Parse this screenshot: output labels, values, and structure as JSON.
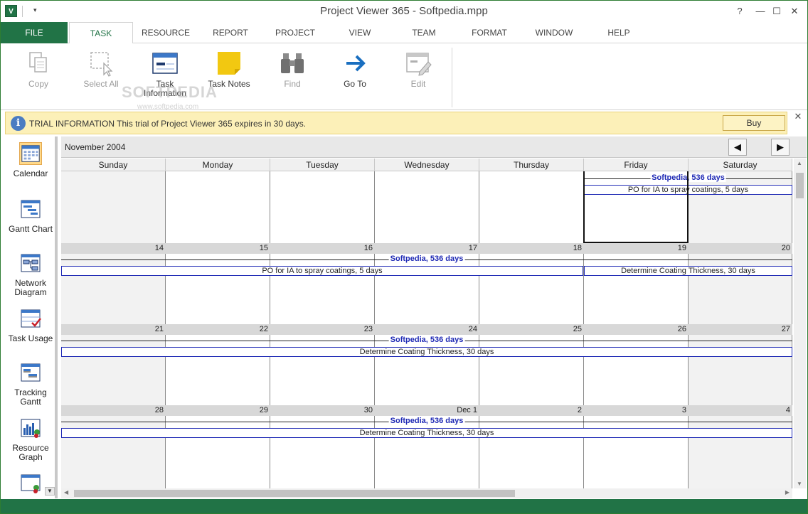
{
  "window": {
    "title": "Project Viewer 365 - Softpedia.mpp",
    "app_icon_text": "V",
    "controls": {
      "help": "?",
      "minimize": "—",
      "maximize": "☐",
      "close": "✕"
    }
  },
  "tabs": {
    "file": "FILE",
    "items": [
      {
        "label": "TASK"
      },
      {
        "label": "RESOURCE"
      },
      {
        "label": "REPORT"
      },
      {
        "label": "PROJECT"
      },
      {
        "label": "VIEW"
      },
      {
        "label": "TEAM"
      },
      {
        "label": "FORMAT"
      },
      {
        "label": "WINDOW"
      },
      {
        "label": "HELP"
      }
    ],
    "active": "TASK"
  },
  "ribbon": {
    "copy": "Copy",
    "select_all": "Select All",
    "task_information_1": "Task",
    "task_information_2": "Information",
    "task_notes": "Task Notes",
    "find": "Find",
    "go_to": "Go To",
    "edit": "Edit",
    "watermark": "SOFTPEDIA",
    "watermark_url": "www.softpedia.com"
  },
  "trial": {
    "icon": "i",
    "message": "TRIAL INFORMATION This trial of Project Viewer 365 expires in 30 days.",
    "buy": "Buy",
    "close": "✕"
  },
  "viewbar": {
    "calendar": "Calendar",
    "gantt_chart": "Gantt Chart",
    "network_1": "Network",
    "network_2": "Diagram",
    "task_usage": "Task Usage",
    "tracking_1": "Tracking",
    "tracking_2": "Gantt",
    "resource_1": "Resource",
    "resource_2": "Graph"
  },
  "calendar": {
    "month": "November 2004",
    "prev": "◀",
    "next": "▶",
    "days": [
      "Sunday",
      "Monday",
      "Tuesday",
      "Wednesday",
      "Thursday",
      "Friday",
      "Saturday"
    ],
    "weeks": [
      {
        "dates": [
          "",
          "",
          "",
          "",
          "",
          "",
          ""
        ]
      },
      {
        "dates": [
          "14",
          "15",
          "16",
          "17",
          "18",
          "19",
          "20"
        ]
      },
      {
        "dates": [
          "21",
          "22",
          "23",
          "24",
          "25",
          "26",
          "27"
        ]
      },
      {
        "dates": [
          "28",
          "29",
          "30",
          "Dec 1",
          "2",
          "3",
          "4"
        ]
      }
    ],
    "summary_label": "Softpedia, 536 days",
    "task_po": "PO for IA to spray coatings, 5 days",
    "task_coat": "Determine Coating Thickness, 30 days"
  },
  "colors": {
    "accent": "#217346",
    "task_border": "#1f2ab5",
    "trial_bg": "#fcf0b8"
  }
}
